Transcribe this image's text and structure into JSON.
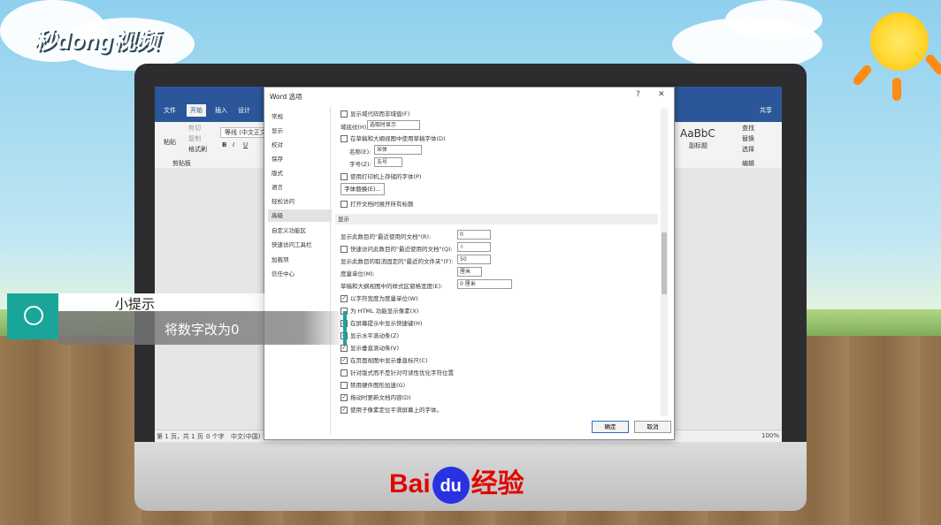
{
  "brand": {
    "logo_text": "秒dong视频"
  },
  "baidu": {
    "pre": "Bai",
    "du": "du",
    "post": "经验"
  },
  "word": {
    "tabs": [
      "文件",
      "开始",
      "插入",
      "设计"
    ],
    "share": "共享",
    "ribbon": {
      "paste": "粘贴",
      "cut": "剪切",
      "copy": "复制",
      "format_painter": "格式刷",
      "clipboard": "剪贴板",
      "font_name": "等线 (中文正文)",
      "bold": "B",
      "italic": "I",
      "underline": "U",
      "style_sample": "AaBbC",
      "style_label": "副标题",
      "find": "查找",
      "replace": "替换",
      "select": "选择",
      "editing": "编辑"
    },
    "status": {
      "page": "第 1 页，共 1 页",
      "words": "0 个字",
      "lang": "中文(中国)",
      "zoom": "100%"
    }
  },
  "dialog": {
    "title": "Word 选项",
    "help": "?",
    "close": "✕",
    "nav": [
      "常规",
      "显示",
      "校对",
      "保存",
      "版式",
      "语言",
      "轻松访问",
      "高级",
      "自定义功能区",
      "快速访问工具栏",
      "加载项",
      "信任中心"
    ],
    "nav_active": "高级",
    "rows": [
      {
        "text": "显示域代码而非域值(F)",
        "checked": false
      },
      {
        "text": "域底纹(H):",
        "value": "选取时显示"
      },
      {
        "text": "在草稿和大纲视图中使用草稿字体(D)",
        "checked": false
      },
      {
        "text": "名称(E):",
        "value": "宋体"
      },
      {
        "text": "字号(Z):",
        "value": "五号"
      },
      {
        "text": "使用打印机上存储的字体(P)",
        "checked": false
      },
      {
        "button": "字体替换(E)..."
      },
      {
        "text": "打开文档时展开所有标题",
        "checked": false
      }
    ],
    "section_display": "显示",
    "display_rows": [
      {
        "text": "显示此数目的\"最近使用的文档\"(R):",
        "value": "0"
      },
      {
        "text": "快速访问此数目的\"最近使用的文档\"(Q):",
        "value": "4",
        "checked": false
      },
      {
        "text": "显示此数目的取消固定的\"最近的文件夹\"(F):",
        "value": "50"
      },
      {
        "text": "度量单位(M):",
        "value": "厘米"
      },
      {
        "text": "草稿和大纲视图中的样式区窗格宽度(E):",
        "value": "0 厘米"
      },
      {
        "text": "以字符宽度为度量单位(W)",
        "checked": true
      },
      {
        "text": "为 HTML 功能显示像素(X)",
        "checked": false
      },
      {
        "text": "在屏幕提示中显示快捷键(H)",
        "checked": true
      },
      {
        "text": "显示水平滚动条(Z)",
        "checked": true
      },
      {
        "text": "显示垂直滚动条(V)",
        "checked": true
      },
      {
        "text": "在页面视图中显示垂直标尺(C)",
        "checked": true
      },
      {
        "text": "针对版式而不是针对可读性优化字符位置",
        "checked": false
      },
      {
        "text": "禁用硬件图形加速(G)",
        "checked": false
      },
      {
        "text": "拖动时更新文档内容(D)",
        "checked": true
      },
      {
        "text": "使用子像素定位平滑屏幕上的字体。",
        "checked": true
      }
    ],
    "ok": "确定",
    "cancel": "取消"
  },
  "tip": {
    "title": "小提示",
    "text": "将数字改为0"
  }
}
